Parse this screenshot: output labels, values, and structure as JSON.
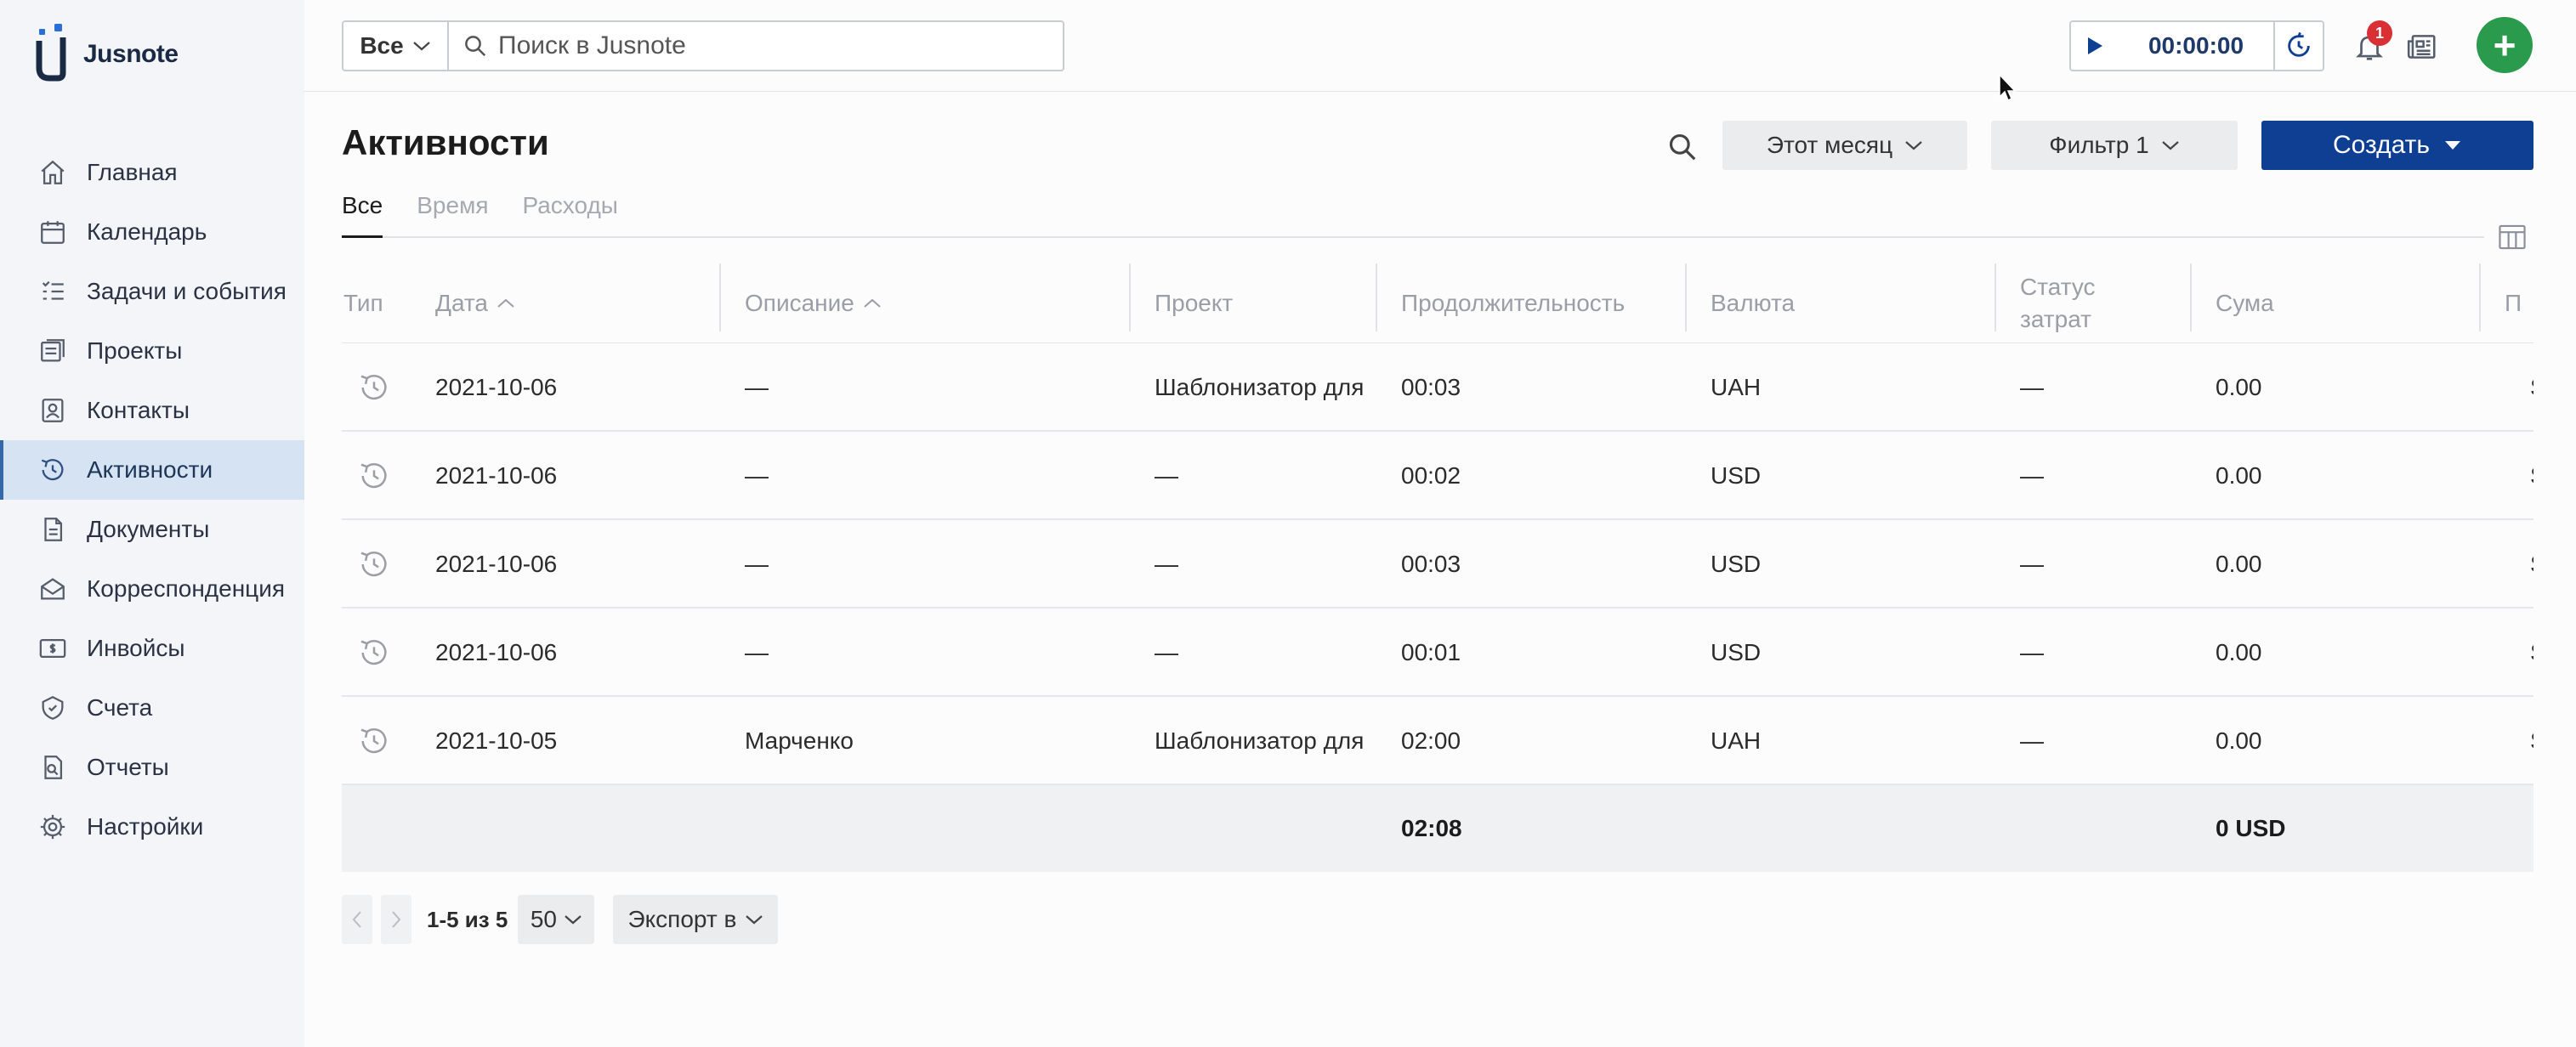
{
  "app": {
    "name": "Jusnote"
  },
  "sidebar": {
    "items": [
      {
        "label": "Главная",
        "icon": "home-icon"
      },
      {
        "label": "Календарь",
        "icon": "calendar-icon"
      },
      {
        "label": "Задачи и события",
        "icon": "tasks-icon"
      },
      {
        "label": "Проекты",
        "icon": "projects-icon"
      },
      {
        "label": "Контакты",
        "icon": "contacts-icon"
      },
      {
        "label": "Активности",
        "icon": "activity-icon",
        "active": true
      },
      {
        "label": "Документы",
        "icon": "documents-icon"
      },
      {
        "label": "Корреспонденция",
        "icon": "mail-icon"
      },
      {
        "label": "Инвойсы",
        "icon": "invoice-icon"
      },
      {
        "label": "Счета",
        "icon": "accounts-icon"
      },
      {
        "label": "Отчеты",
        "icon": "reports-icon"
      },
      {
        "label": "Настройки",
        "icon": "settings-icon"
      }
    ]
  },
  "topbar": {
    "scope": "Все",
    "search_placeholder": "Поиск в Jusnote",
    "timer": "00:00:00",
    "notifications_count": "1",
    "add_label": "+"
  },
  "page": {
    "title": "Активности",
    "period": "Этот месяц",
    "filter": "Фильтр 1",
    "create": "Создать"
  },
  "tabs": [
    {
      "label": "Все",
      "active": true
    },
    {
      "label": "Время"
    },
    {
      "label": "Расходы"
    }
  ],
  "table": {
    "headers": {
      "type": "Тип",
      "date": "Дата",
      "description": "Описание",
      "project": "Проект",
      "duration": "Продолжительность",
      "currency": "Валюта",
      "status_line1": "Статус",
      "status_line2": "затрат",
      "sum": "Сума",
      "next": "П"
    },
    "rows": [
      {
        "date": "2021-10-06",
        "description": "—",
        "project": "Шаблонизатор для",
        "duration": "00:03",
        "currency": "UAH",
        "status": "—",
        "sum": "0.00",
        "next": "S"
      },
      {
        "date": "2021-10-06",
        "description": "—",
        "project": "—",
        "duration": "00:02",
        "currency": "USD",
        "status": "—",
        "sum": "0.00",
        "next": "S"
      },
      {
        "date": "2021-10-06",
        "description": "—",
        "project": "—",
        "duration": "00:03",
        "currency": "USD",
        "status": "—",
        "sum": "0.00",
        "next": "S"
      },
      {
        "date": "2021-10-06",
        "description": "—",
        "project": "—",
        "duration": "00:01",
        "currency": "USD",
        "status": "—",
        "sum": "0.00",
        "next": "S"
      },
      {
        "date": "2021-10-05",
        "description": "Марченко",
        "project": "Шаблонизатор для",
        "duration": "02:00",
        "currency": "UAH",
        "status": "—",
        "sum": "0.00",
        "next": "S"
      }
    ],
    "totals": {
      "duration": "02:08",
      "sum": "0 USD"
    }
  },
  "pagination": {
    "range": "1-5 из 5",
    "page_size": "50",
    "export": "Экспорт в"
  },
  "colors": {
    "accent": "#0f3f92",
    "sidebar_bg": "#f3f5f8",
    "sidebar_active": "#d6e3f3",
    "fab": "#2a9a4d",
    "badge": "#d93036"
  }
}
